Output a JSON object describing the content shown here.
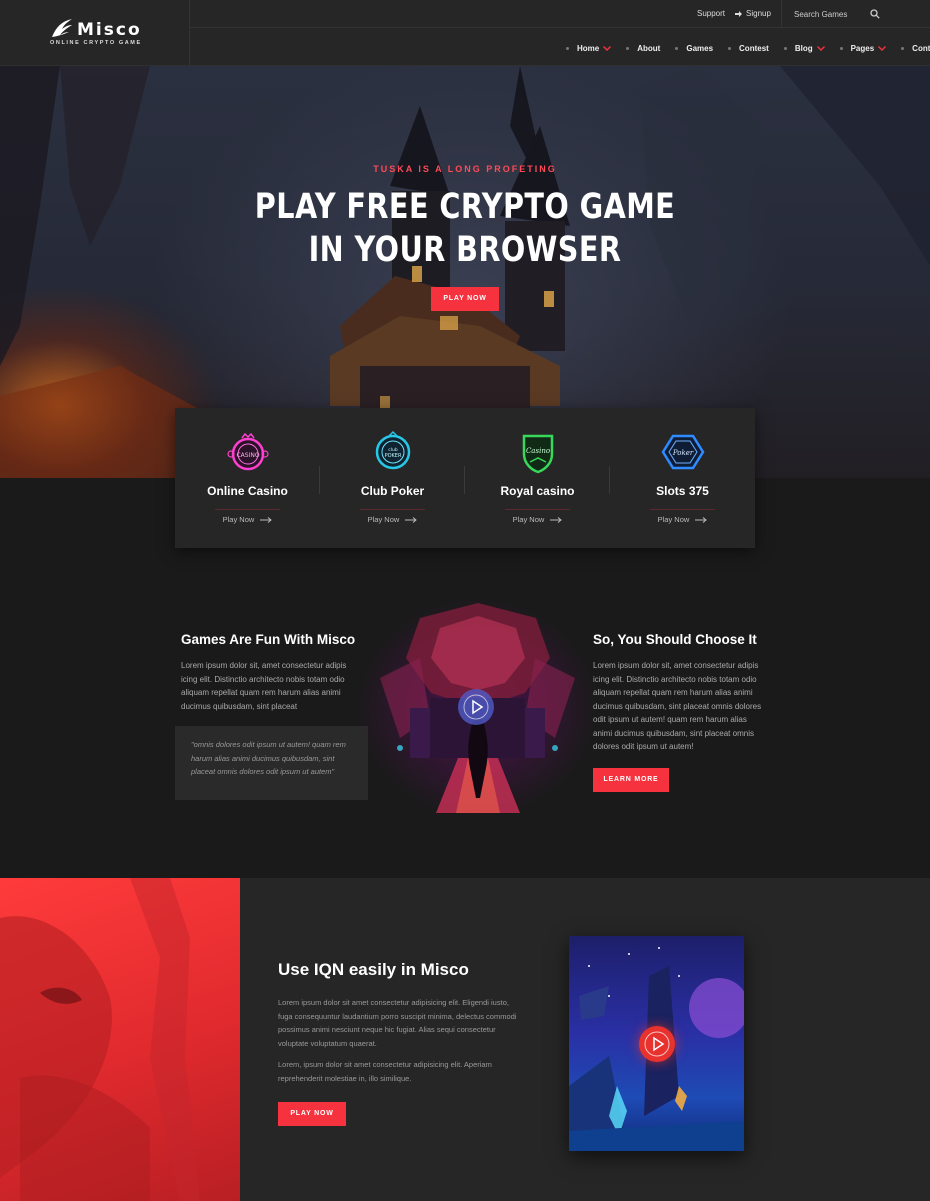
{
  "brand": {
    "name": "Misco",
    "tagline": "ONLINE CRYPTO GAME",
    "logo_icon": "feather-wing-icon"
  },
  "topbar": {
    "support": "Support",
    "signup": "Signup",
    "search_placeholder": "Search Games",
    "search_icon": "search-icon"
  },
  "nav": {
    "items": [
      {
        "label": "Home",
        "dropdown": true
      },
      {
        "label": "About",
        "dropdown": false
      },
      {
        "label": "Games",
        "dropdown": false
      },
      {
        "label": "Contest",
        "dropdown": false
      },
      {
        "label": "Blog",
        "dropdown": true
      },
      {
        "label": "Pages",
        "dropdown": true
      },
      {
        "label": "Contact",
        "dropdown": false
      }
    ]
  },
  "hero": {
    "subtitle": "TUSKA IS A LONG PROFETING",
    "title_line1": "PLAY FREE CRYPTO GAME",
    "title_line2": "IN YOUR BROWSER",
    "button": "PLAY NOW"
  },
  "games": [
    {
      "title": "Online Casino",
      "link": "Play Now",
      "icon": "casino-neon-icon",
      "color": "#ff3fd0"
    },
    {
      "title": "Club Poker",
      "link": "Play Now",
      "icon": "club-poker-badge-icon",
      "color": "#28c7e8"
    },
    {
      "title": "Royal casino",
      "link": "Play Now",
      "icon": "royal-casino-shield-icon",
      "color": "#38d85a"
    },
    {
      "title": "Slots 375",
      "link": "Play Now",
      "icon": "poker-hexagon-icon",
      "color": "#2f8bff"
    }
  ],
  "about": {
    "left_title": "Games Are Fun With Misco",
    "left_text": "Lorem ipsum dolor sit, amet consectetur adipis icing elit. Distinctio architecto nobis totam odio aliquam repellat quam rem harum alias animi ducimus quibusdam, sint placeat",
    "quote": "\"omnis dolores odit ipsum ut autem! quam rem harum alias animi ducimus quibusdam, sint placeat omnis dolores odit ipsum ut autem\"",
    "right_title": "So, You Should Choose It",
    "right_text": "Lorem ipsum dolor sit, amet consectetur adipis icing elit. Distinctio architecto nobis totam odio aliquam repellat quam rem harum alias animi ducimus quibusdam, sint placeat omnis dolores odit ipsum ut autem! quam rem harum alias animi ducimus quibusdam, sint placeat omnis dolores odit ipsum ut autem!",
    "button": "LEARN MORE"
  },
  "bottom": {
    "title": "Use IQN easily in Misco",
    "para1": "Lorem ipsum dolor sit amet consectetur adipisicing elit. Eligendi iusto, fuga consequuntur laudantium porro suscipit minima, delectus commodi possimus animi nesciunt neque hic fugiat. Alias sequi consectetur voluptate voluptatum quaerat.",
    "para2": "Lorem, ipsum dolor sit amet consectetur adipisicing elit. Aperiam reprehenderit molestiae in, illo similique.",
    "button": "PLAY NOW"
  },
  "colors": {
    "accent": "#f5323d",
    "background": "#1a1a1a",
    "panel": "#262626"
  }
}
